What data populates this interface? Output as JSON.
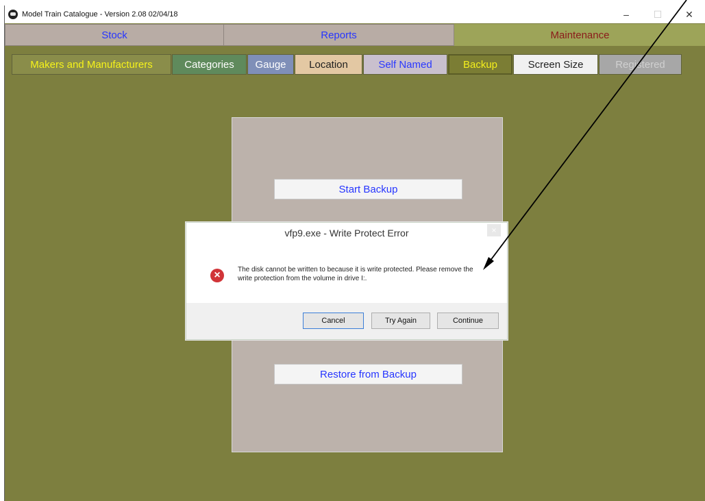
{
  "window": {
    "title": "Model Train Catalogue - Version 2.08  02/04/18",
    "controls": {
      "minimize": "–",
      "maximize": "☐",
      "close": "✕"
    }
  },
  "top_tabs": [
    {
      "label": "Stock"
    },
    {
      "label": "Reports"
    },
    {
      "label": "Maintenance"
    }
  ],
  "sub_tabs": [
    {
      "label": "Makers and Manufacturers"
    },
    {
      "label": "Categories"
    },
    {
      "label": "Gauge"
    },
    {
      "label": "Location"
    },
    {
      "label": "Self Named"
    },
    {
      "label": "Backup"
    },
    {
      "label": "Screen Size"
    },
    {
      "label": "Registered"
    }
  ],
  "backup_panel": {
    "start_label": "Start Backup",
    "restore_label": "Restore from Backup"
  },
  "dialog": {
    "title": "vfp9.exe - Write Protect Error",
    "close": "×",
    "icon": "error-icon",
    "message": "The disk cannot be written to because it is write protected. Please remove the write protection from the volume  in drive I:.",
    "buttons": {
      "cancel": "Cancel",
      "try_again": "Try Again",
      "continue": "Continue"
    }
  },
  "colors": {
    "background": "#7d7f3f",
    "panel": "#bcb2ab",
    "link_blue": "#2635ff",
    "error_red": "#d13438"
  }
}
